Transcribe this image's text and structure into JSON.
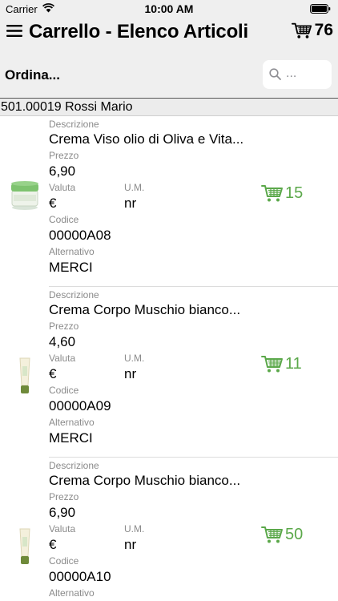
{
  "status": {
    "carrier": "Carrier",
    "time": "10:00 AM"
  },
  "nav": {
    "title": "Carrello - Elenco Articoli",
    "cart_count": "76"
  },
  "toolbar": {
    "sort_label": "Ordina...",
    "search_placeholder": "..."
  },
  "customer": "501.00019 Rossi Mario",
  "accent_color": "#5ba84a",
  "labels": {
    "description": "Descrizione",
    "price": "Prezzo",
    "currency": "Valuta",
    "unit": "U.M.",
    "code": "Codice",
    "alternative": "Alternativo"
  },
  "items": [
    {
      "description": "Crema Viso olio di Oliva e Vita...",
      "price": "6,90",
      "currency": "€",
      "unit": "nr",
      "code": "00000A08",
      "alternative": "MERCI",
      "quantity": "15",
      "image": "green-jar-icon"
    },
    {
      "description": "Crema Corpo Muschio bianco...",
      "price": "4,60",
      "currency": "€",
      "unit": "nr",
      "code": "00000A09",
      "alternative": "MERCI",
      "quantity": "11",
      "image": "cream-tube-icon"
    },
    {
      "description": "Crema Corpo Muschio bianco...",
      "price": "6,90",
      "currency": "€",
      "unit": "nr",
      "code": "00000A10",
      "alternative": "",
      "quantity": "50",
      "image": "cream-tube-icon"
    }
  ]
}
